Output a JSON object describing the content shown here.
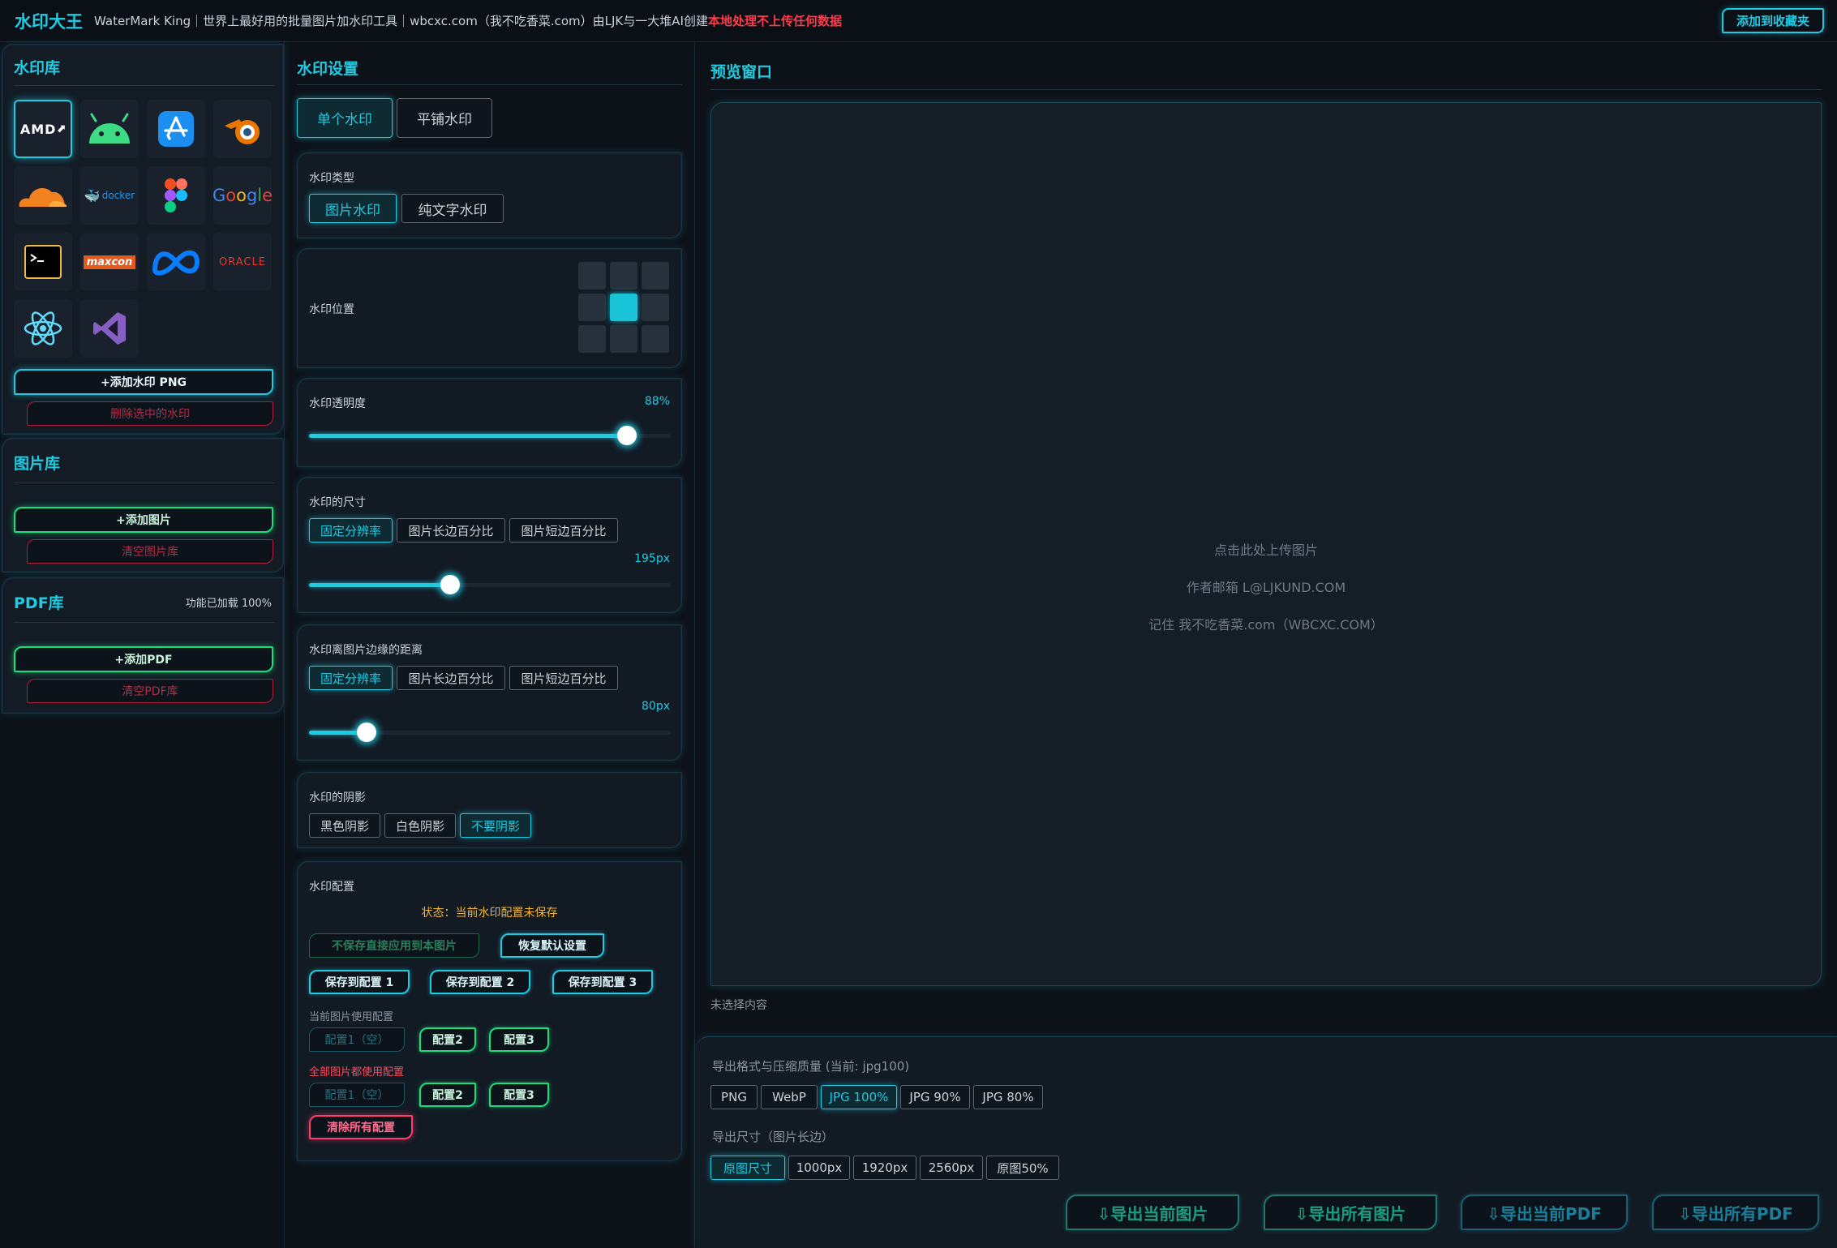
{
  "header": {
    "app_title": "水印大王",
    "description": "WaterMark King｜世界上最好用的批量图片加水印工具｜wbcxc.com（我不吃香菜.com）由LJK与一大堆AI创建 ",
    "warning": "本地处理不上传任何数据",
    "favorite_button": "添加到收藏夹"
  },
  "watermark_library": {
    "title": "水印库",
    "logos": [
      "amd-logo",
      "android-logo",
      "app-store-logo",
      "blender-logo",
      "cloudflare-logo",
      "docker-logo",
      "figma-logo",
      "google-logo",
      "terminal-logo",
      "maxcon-logo",
      "meta-logo",
      "oracle-logo",
      "react-logo",
      "visual-studio-logo"
    ],
    "logo_texts": {
      "amd": "AMD",
      "docker": "docker",
      "google": "Google",
      "maxcon": "maxcon",
      "oracle": "ORACLE"
    },
    "add_button": "+添加水印 PNG",
    "delete_button": "删除选中的水印"
  },
  "image_library": {
    "title": "图片库",
    "add_button": "+添加图片",
    "clear_button": "清空图片库"
  },
  "pdf_library": {
    "title": "PDF库",
    "status": "功能已加载 100%",
    "add_button": "+添加PDF",
    "clear_button": "清空PDF库"
  },
  "settings": {
    "title": "水印设置",
    "mode_tabs": [
      "单个水印",
      "平铺水印"
    ],
    "type": {
      "label": "水印类型",
      "options": [
        "图片水印",
        "纯文字水印"
      ]
    },
    "position": {
      "label": "水印位置",
      "selected_index": 4
    },
    "opacity": {
      "label": "水印透明度",
      "value_text": "88%",
      "value": 0.88
    },
    "size": {
      "label": "水印的尺寸",
      "options": [
        "固定分辨率",
        "图片长边百分比",
        "图片短边百分比"
      ],
      "value_text": "195px",
      "fraction": 0.39
    },
    "margin": {
      "label": "水印离图片边缘的距离",
      "options": [
        "固定分辨率",
        "图片长边百分比",
        "图片短边百分比"
      ],
      "value_text": "80px",
      "fraction": 0.16
    },
    "shadow": {
      "label": "水印的阴影",
      "options": [
        "黑色阴影",
        "白色阴影",
        "不要阴影"
      ]
    },
    "config": {
      "label": "水印配置",
      "status": "状态：当前水印配置未保存",
      "apply_without_save": "不保存直接应用到本图片",
      "restore_default": "恢复默认设置",
      "save_buttons": [
        "保存到配置 1",
        "保存到配置 2",
        "保存到配置 3"
      ],
      "current_label": "当前图片使用配置",
      "all_label": "全部图片都使用配置",
      "slots": [
        "配置1（空）",
        "配置2",
        "配置3"
      ],
      "clear_all": "清除所有配置"
    }
  },
  "preview": {
    "title": "预览窗口",
    "upload_hint": "点击此处上传图片",
    "author_email": "作者邮箱 L@LJKUND.COM",
    "remember": "记住 我不吃香菜.com（WBCXC.COM）",
    "selection_status": "未选择内容"
  },
  "export": {
    "format_label": "导出格式与压缩质量 (当前: jpg100)",
    "formats": [
      "PNG",
      "WebP",
      "JPG 100%",
      "JPG 90%",
      "JPG 80%"
    ],
    "size_label": "导出尺寸（图片长边）",
    "sizes": [
      "原图尺寸",
      "1000px",
      "1920px",
      "2560px",
      "原图50%"
    ],
    "actions": [
      "⇩导出当前图片",
      "⇩导出所有图片",
      "⇩导出当前PDF",
      "⇩导出所有PDF"
    ]
  },
  "colors": {
    "accent": "#1ecbe1",
    "green": "#19e07d",
    "danger": "#ff3c6a",
    "warning": "#f2b632",
    "background": "#0d1219"
  }
}
